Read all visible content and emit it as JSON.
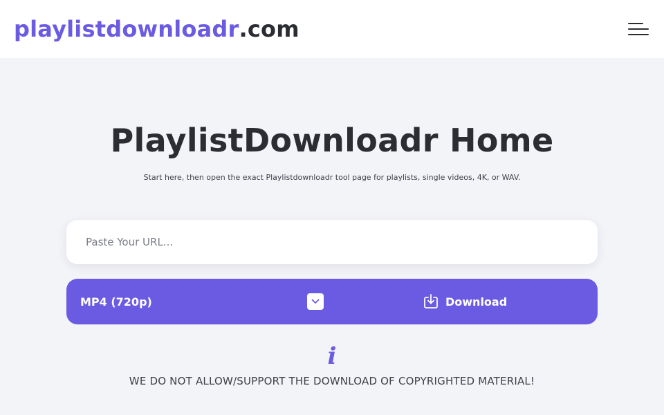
{
  "header": {
    "logo_brand": "playlistdownloadr",
    "logo_tld": ".com",
    "menu_icon": "hamburger-menu-icon"
  },
  "hero": {
    "title": "PlaylistDownloadr Home",
    "subtitle": "Start here, then open the exact Playlistdownloadr tool page for playlists, single videos, 4K, or WAV."
  },
  "form": {
    "url_placeholder": "Paste Your URL...",
    "url_value": "",
    "format_selected": "MP4 (720p)",
    "download_label": "Download"
  },
  "notice": {
    "icon": "info-icon",
    "text": "WE DO NOT ALLOW/SUPPORT THE DOWNLOAD OF COPYRIGHTED MATERIAL!"
  },
  "colors": {
    "accent": "#6b5be3",
    "background": "#f3f4f8",
    "text": "#2b2d33"
  }
}
